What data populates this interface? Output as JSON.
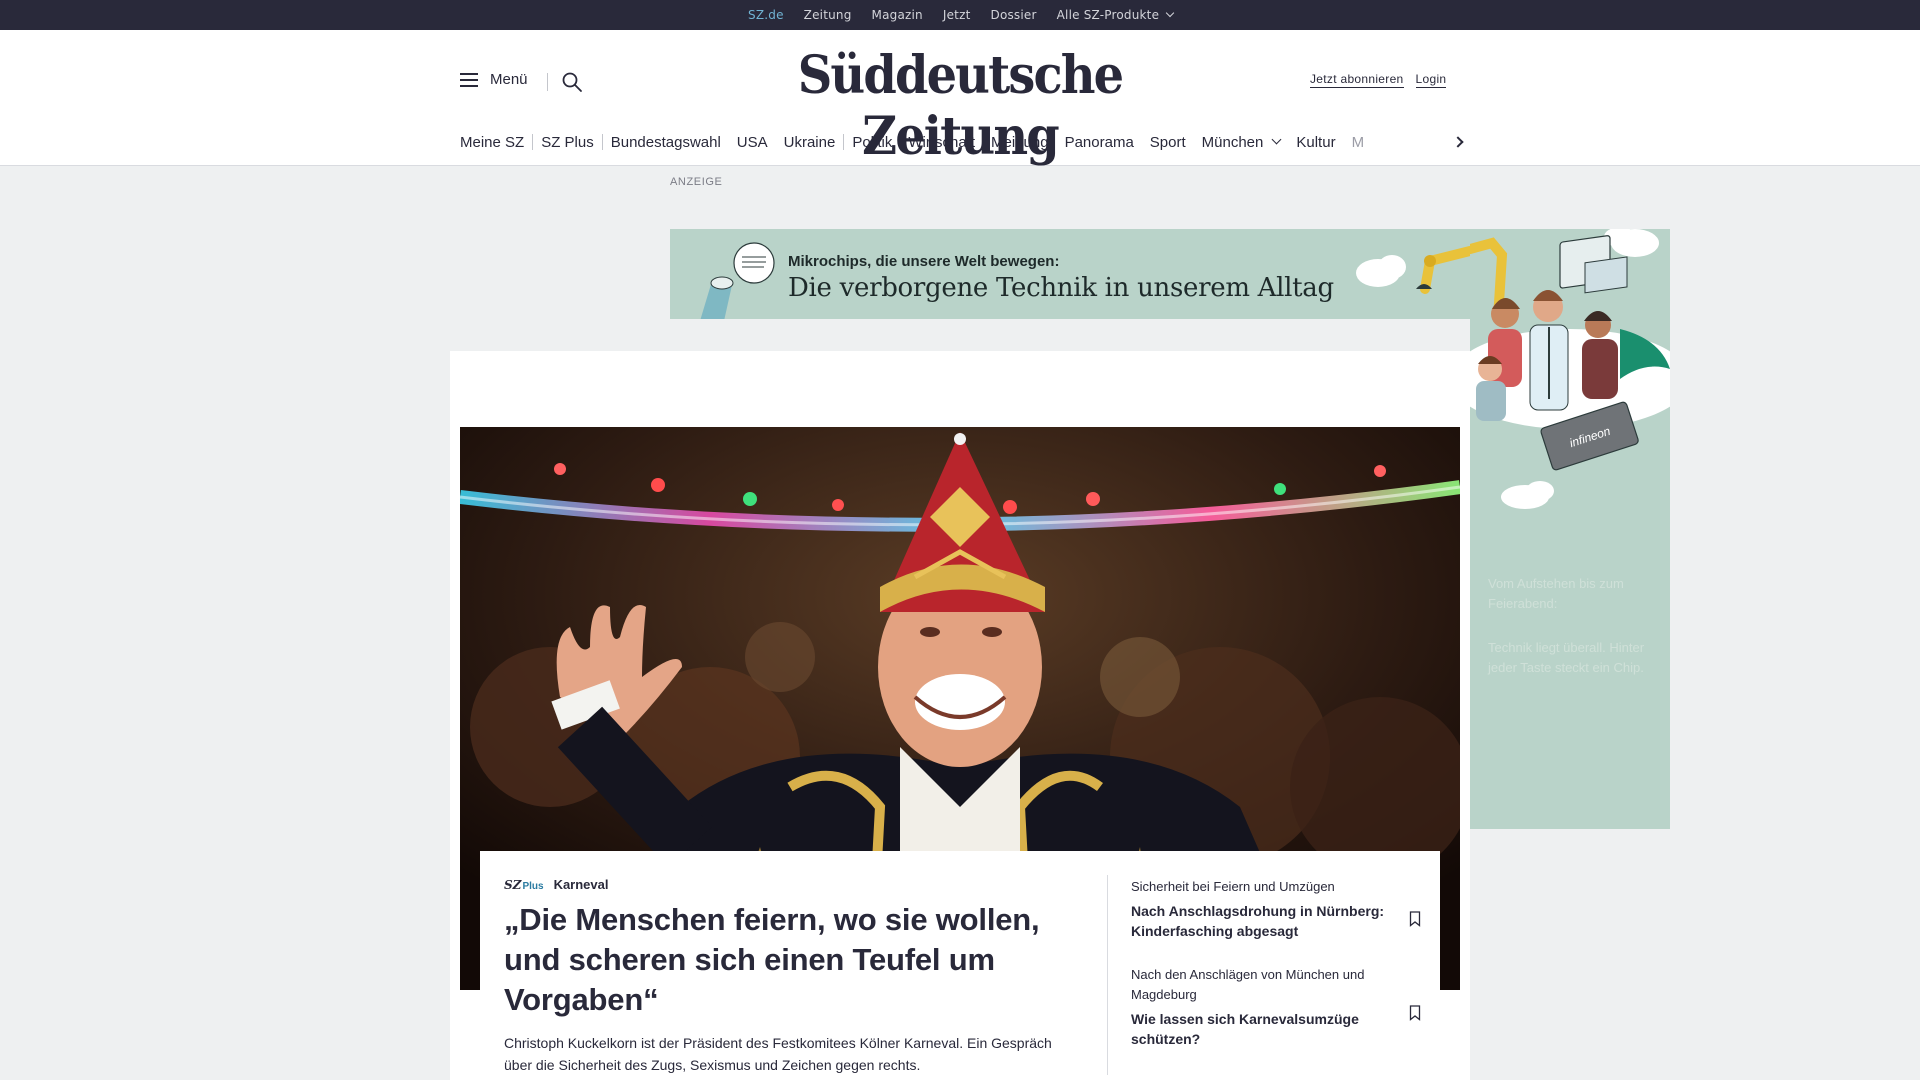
{
  "topnav": {
    "items": [
      "SZ.de",
      "Zeitung",
      "Magazin",
      "Jetzt",
      "Dossier",
      "Alle SZ-Produkte"
    ],
    "active": "SZ.de"
  },
  "header": {
    "menu_label": "Menü",
    "logo_text": "Süddeutsche Zeitung",
    "subscribe_label": "Jetzt abonnieren",
    "login_label": "Login"
  },
  "mainnav": {
    "items": [
      "Meine SZ",
      "SZ Plus",
      "Bundestagswahl",
      "USA",
      "Ukraine",
      "Politik",
      "Wirtschaft",
      "Meinung",
      "Panorama",
      "Sport",
      "München",
      "Kultur",
      "M"
    ]
  },
  "ad": {
    "label": "ANZEIGE",
    "kicker": "Mikrochips, die unsere Welt bewegen:",
    "title": "Die verborgene Technik in unserem Alltag",
    "brand": "infineon",
    "faint_text_1": "Vom Aufstehen bis zum Feierabend:",
    "faint_text_2": "Technik liegt überall. Hinter jeder Taste steckt ein Chip."
  },
  "teaser": {
    "badge": "SZ",
    "badge_plus": "Plus",
    "kicker": "Karneval",
    "headline": "„Die Menschen feiern, wo sie wollen, und scheren sich einen Teufel um Vorgaben“",
    "summary": "Christoph Kuckelkorn ist der Präsident des Festkomitees Kölner Karneval. Ein Gespräch über die Sicherheit des Zugs, Sexismus und Zeichen gegen rechts."
  },
  "side_articles": [
    {
      "kicker": "Sicherheit bei Feiern und Umzügen",
      "title": "Nach Anschlagsdrohung in Nürnberg: Kinderfasching abgesagt"
    },
    {
      "kicker": "Nach den Anschlägen von München und Magdeburg",
      "title": "Wie lassen sich Karnevalsumzüge schützen?"
    }
  ],
  "colors": {
    "topbar_bg": "#29293a",
    "active_link": "#71b3d3",
    "ad_bg": "#b9d3c9",
    "page_bg": "#eef0f1"
  }
}
